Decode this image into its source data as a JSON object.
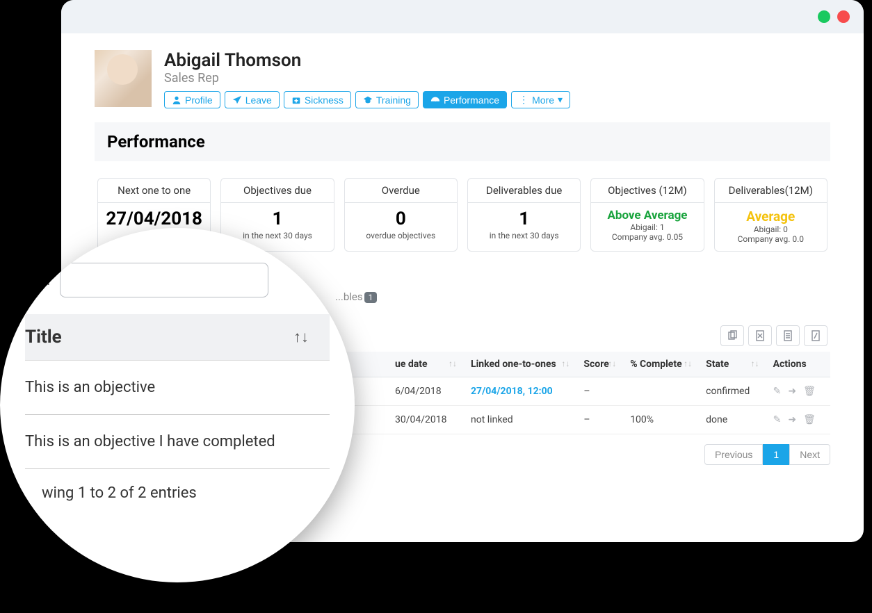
{
  "window": {
    "controls": {
      "green": "#19c95f",
      "red": "#f74c4c"
    }
  },
  "profile": {
    "name": "Abigail Thomson",
    "role": "Sales Rep"
  },
  "nav_tabs": {
    "profile": "Profile",
    "leave": "Leave",
    "sickness": "Sickness",
    "training": "Training",
    "performance": "Performance",
    "more": "More"
  },
  "section_heading": "Performance",
  "cards": [
    {
      "header": "Next one to one",
      "big": "27/04/2018",
      "sub": ""
    },
    {
      "header": "Objectives due",
      "big": "1",
      "sub": "in the next 30 days"
    },
    {
      "header": "Overdue",
      "big": "0",
      "sub": "overdue objectives"
    },
    {
      "header": "Deliverables due",
      "big": "1",
      "sub": "in the next 30 days"
    },
    {
      "header": "Objectives (12M)",
      "rating": "Above Average",
      "rating_class": "above",
      "line1": "Abigail: 1",
      "line2": "Company avg. 0.05"
    },
    {
      "header": "Deliverables(12M)",
      "rating": "Average",
      "rating_class": "avg",
      "line1": "Abigail: 0",
      "line2": "Company avg. 0.0"
    }
  ],
  "subtab": {
    "label": "...bles",
    "badge": "1"
  },
  "table": {
    "columns": {
      "due_date": "ue date",
      "linked": "Linked one-to-ones",
      "score": "Score",
      "complete": "% Complete",
      "state": "State",
      "actions": "Actions"
    },
    "rows": [
      {
        "due": "6/04/2018",
        "linked": "27/04/2018, 12:00",
        "linked_is_link": true,
        "score": "–",
        "complete": "",
        "state": "confirmed"
      },
      {
        "due": "30/04/2018",
        "linked": "not linked",
        "linked_is_link": false,
        "score": "–",
        "complete": "100%",
        "state": "done"
      }
    ],
    "pagination": {
      "prev": "Previous",
      "page": "1",
      "next": "Next"
    }
  },
  "zoom": {
    "search_label": "rch:",
    "title_header": "Title",
    "rows": [
      "This is an objective",
      "This is an objective I have completed"
    ],
    "footer": "wing 1 to 2 of 2 entries"
  }
}
